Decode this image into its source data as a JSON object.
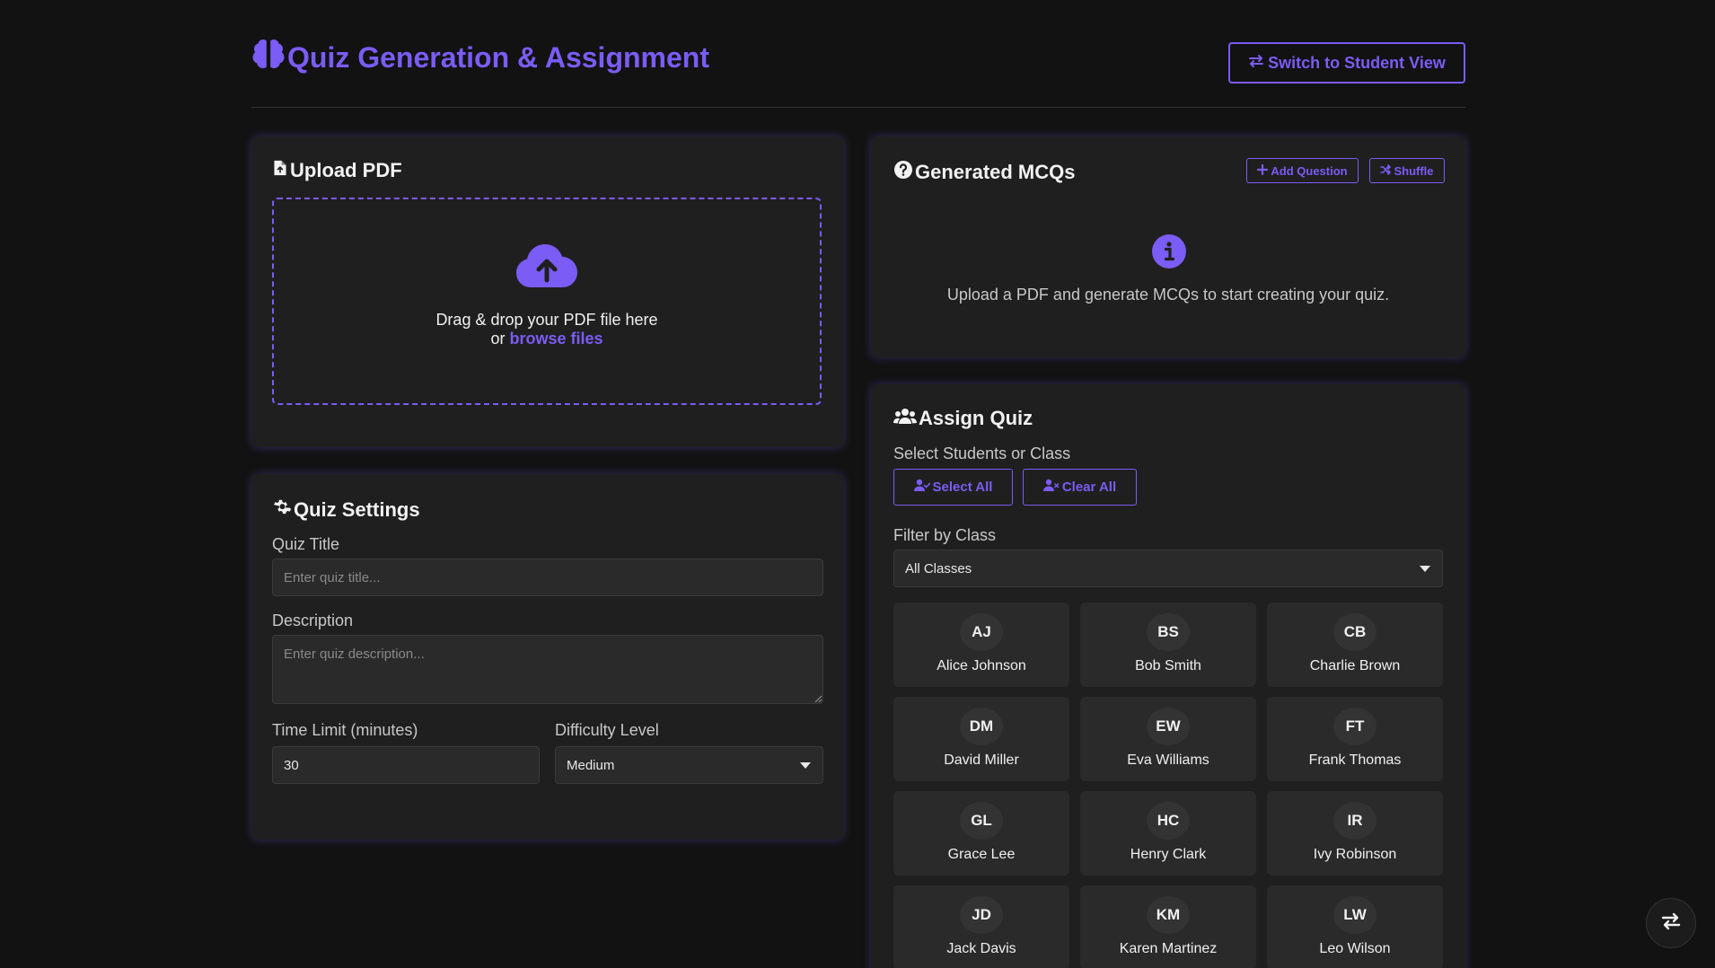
{
  "header": {
    "title": "Quiz Generation & Assignment",
    "switch_view_label": "Switch to Student View"
  },
  "upload": {
    "title": "Upload PDF",
    "drop_text": "Drag & drop your PDF file here",
    "or_text": "or",
    "browse_label": "browse files"
  },
  "settings": {
    "title": "Quiz Settings",
    "quiz_title_label": "Quiz Title",
    "quiz_title_placeholder": "Enter quiz title...",
    "description_label": "Description",
    "description_placeholder": "Enter quiz description...",
    "time_limit_label": "Time Limit (minutes)",
    "time_limit_value": "30",
    "difficulty_label": "Difficulty Level",
    "difficulty_value": "Medium"
  },
  "mcq": {
    "title": "Generated MCQs",
    "add_question_label": "Add Question",
    "shuffle_label": "Shuffle",
    "empty_message": "Upload a PDF and generate MCQs to start creating your quiz."
  },
  "assign": {
    "title": "Assign Quiz",
    "select_label": "Select Students or Class",
    "select_all_label": "Select All",
    "clear_all_label": "Clear All",
    "filter_label": "Filter by Class",
    "filter_value": "All Classes",
    "students": [
      {
        "initials": "AJ",
        "name": "Alice Johnson"
      },
      {
        "initials": "BS",
        "name": "Bob Smith"
      },
      {
        "initials": "CB",
        "name": "Charlie Brown"
      },
      {
        "initials": "DM",
        "name": "David Miller"
      },
      {
        "initials": "EW",
        "name": "Eva Williams"
      },
      {
        "initials": "FT",
        "name": "Frank Thomas"
      },
      {
        "initials": "GL",
        "name": "Grace Lee"
      },
      {
        "initials": "HC",
        "name": "Henry Clark"
      },
      {
        "initials": "IR",
        "name": "Ivy Robinson"
      },
      {
        "initials": "JD",
        "name": "Jack Davis"
      },
      {
        "initials": "KM",
        "name": "Karen Martinez"
      },
      {
        "initials": "LW",
        "name": "Leo Wilson"
      }
    ]
  },
  "colors": {
    "accent": "#7b5cf5",
    "background": "#121212",
    "panel": "#1f1f1f"
  }
}
